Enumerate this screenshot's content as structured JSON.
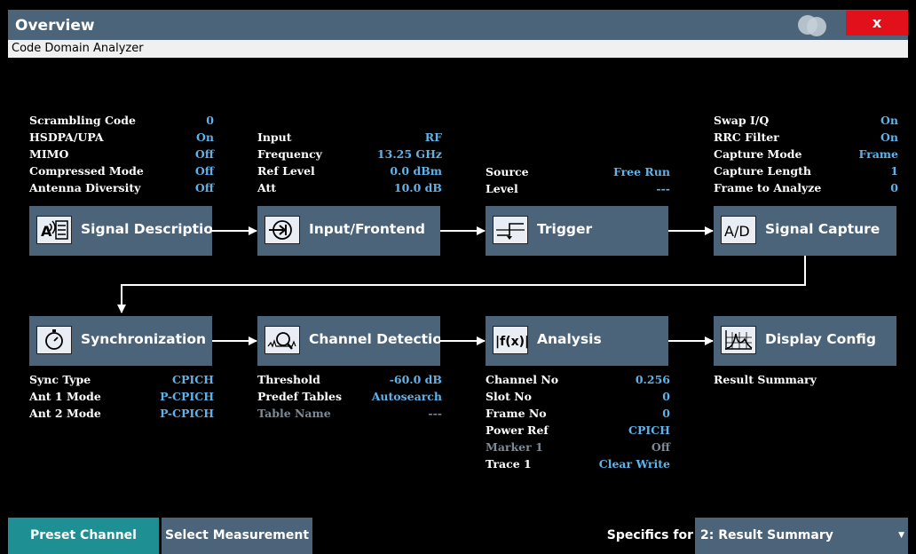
{
  "window": {
    "title": "Overview",
    "subtitle": "Code Domain Analyzer",
    "close_label": "x"
  },
  "groups": {
    "signal_description": {
      "params": [
        {
          "label": "Scrambling Code",
          "value": "0"
        },
        {
          "label": "HSDPA/UPA",
          "value": "On"
        },
        {
          "label": "MIMO",
          "value": "Off"
        },
        {
          "label": "Compressed Mode",
          "value": "Off"
        },
        {
          "label": "Antenna Diversity",
          "value": "Off"
        }
      ]
    },
    "input_frontend": {
      "params": [
        {
          "label": "Input",
          "value": "RF"
        },
        {
          "label": "Frequency",
          "value": "13.25 GHz"
        },
        {
          "label": "Ref Level",
          "value": "0.0 dBm"
        },
        {
          "label": "Att",
          "value": "10.0 dB"
        }
      ]
    },
    "trigger": {
      "params": [
        {
          "label": "Source",
          "value": "Free Run"
        },
        {
          "label": "Level",
          "value": "---"
        }
      ]
    },
    "signal_capture": {
      "params": [
        {
          "label": "Swap I/Q",
          "value": "On"
        },
        {
          "label": "RRC Filter",
          "value": "On"
        },
        {
          "label": "Capture Mode",
          "value": "Frame"
        },
        {
          "label": "Capture Length",
          "value": "1"
        },
        {
          "label": "Frame to Analyze",
          "value": "0"
        }
      ]
    },
    "synchronization": {
      "params": [
        {
          "label": "Sync Type",
          "value": "CPICH"
        },
        {
          "label": "Ant 1 Mode",
          "value": "P-CPICH"
        },
        {
          "label": "Ant 2 Mode",
          "value": "P-CPICH"
        }
      ]
    },
    "channel_detection": {
      "params": [
        {
          "label": "Threshold",
          "value": "-60.0 dB"
        },
        {
          "label": "Predef Tables",
          "value": "Autosearch"
        },
        {
          "label": "Table Name",
          "value": "---"
        }
      ]
    },
    "analysis": {
      "params": [
        {
          "label": "Channel No",
          "value": "0.256"
        },
        {
          "label": "Slot No",
          "value": "0"
        },
        {
          "label": "Frame No",
          "value": "0"
        },
        {
          "label": "Power Ref",
          "value": "CPICH"
        },
        {
          "label": "Marker 1",
          "value": "Off"
        },
        {
          "label": "Trace 1",
          "value": "Clear Write"
        }
      ]
    },
    "display_config": {
      "params": [
        {
          "label": "Result Summary",
          "value": ""
        }
      ]
    }
  },
  "blocks": {
    "signal_description": "Signal Description",
    "input_frontend": "Input/Frontend",
    "trigger": "Trigger",
    "signal_capture": "Signal Capture",
    "synchronization": "Synchronization",
    "channel_detection": "Channel Detection",
    "analysis": "Analysis",
    "display_config": "Display Config"
  },
  "icons": {
    "signal_description": "signal-description-icon",
    "input_frontend": "input-arrow-icon",
    "trigger": "trigger-icon",
    "signal_capture": "ad-converter-icon",
    "synchronization": "stopwatch-icon",
    "channel_detection": "magnifier-spectrum-icon",
    "analysis": "function-icon",
    "display_config": "display-graph-icon"
  },
  "bottom": {
    "preset": "Preset Channel",
    "select_measurement": "Select Measurement",
    "specifics_label": "Specifics for",
    "specifics_value": "2: Result Summary"
  },
  "colors": {
    "accent": "#5fb3ea",
    "block": "#4b6479",
    "preset": "#1e8f92",
    "close": "#e2101a",
    "dim": "#7c8a96"
  }
}
